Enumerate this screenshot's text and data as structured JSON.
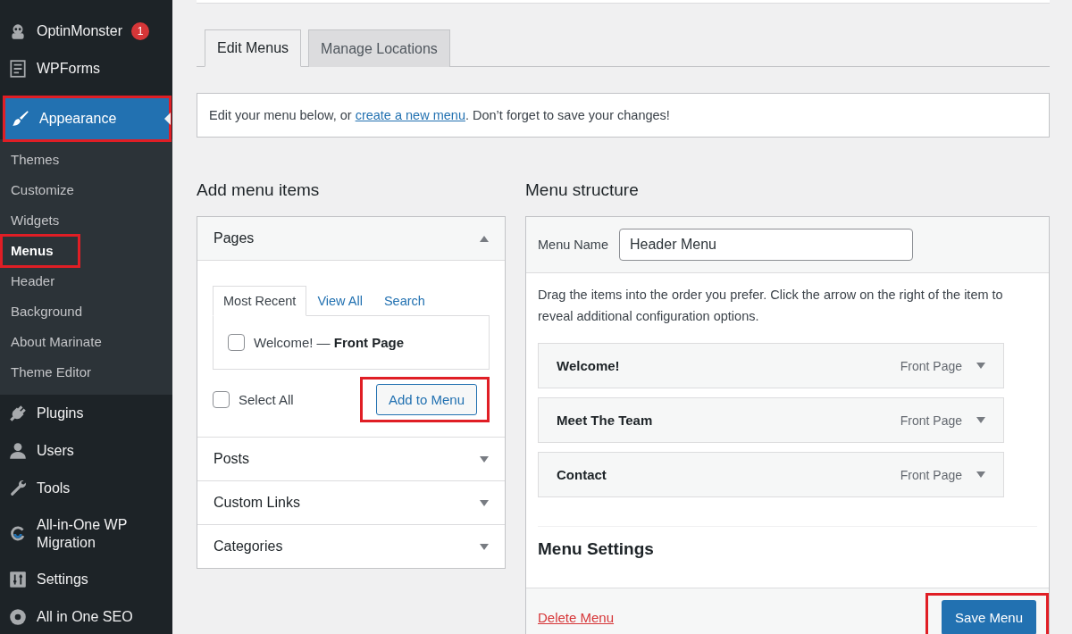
{
  "sidebar": {
    "items": [
      {
        "label": "OptinMonster",
        "badge": "1",
        "selected": false,
        "highlighted": false
      },
      {
        "label": "WPForms",
        "selected": false,
        "highlighted": false
      },
      {
        "label": "Appearance",
        "selected": true,
        "highlighted": true,
        "children": [
          {
            "label": "Themes",
            "selected": false,
            "highlighted": false
          },
          {
            "label": "Customize",
            "selected": false,
            "highlighted": false
          },
          {
            "label": "Widgets",
            "selected": false,
            "highlighted": false
          },
          {
            "label": "Menus",
            "selected": true,
            "highlighted": true
          },
          {
            "label": "Header",
            "selected": false,
            "highlighted": false
          },
          {
            "label": "Background",
            "selected": false,
            "highlighted": false
          },
          {
            "label": "About Marinate",
            "selected": false,
            "highlighted": false
          },
          {
            "label": "Theme Editor",
            "selected": false,
            "highlighted": false
          }
        ]
      },
      {
        "label": "Plugins",
        "selected": false,
        "highlighted": false
      },
      {
        "label": "Users",
        "selected": false,
        "highlighted": false
      },
      {
        "label": "Tools",
        "selected": false,
        "highlighted": false
      },
      {
        "label": "All-in-One WP Migration",
        "selected": false,
        "highlighted": false
      },
      {
        "label": "Settings",
        "selected": false,
        "highlighted": false
      },
      {
        "label": "All in One SEO",
        "selected": false,
        "highlighted": false
      }
    ]
  },
  "tabs": [
    {
      "label": "Edit Menus",
      "selected": true
    },
    {
      "label": "Manage Locations",
      "selected": false
    }
  ],
  "notice": {
    "before": "Edit your menu below, or ",
    "link": "create a new menu",
    "after": ". Don’t forget to save your changes!"
  },
  "add_items": {
    "title": "Add menu items",
    "sections": [
      {
        "title": "Pages",
        "expanded": true,
        "tabs": [
          {
            "label": "Most Recent",
            "selected": true
          },
          {
            "label": "View All",
            "selected": false
          },
          {
            "label": "Search",
            "selected": false
          }
        ],
        "entries": [
          {
            "title": "Welcome!",
            "separator": " — ",
            "state": "Front Page",
            "checked": false
          }
        ],
        "select_all": {
          "label": "Select All",
          "checked": false
        },
        "button": {
          "label": "Add to Menu",
          "highlighted": true
        }
      },
      {
        "title": "Posts",
        "expanded": false
      },
      {
        "title": "Custom Links",
        "expanded": false
      },
      {
        "title": "Categories",
        "expanded": false
      }
    ]
  },
  "structure": {
    "title": "Menu structure",
    "name_label": "Menu Name",
    "name_value": "Header Menu",
    "instructions": "Drag the items into the order you prefer. Click the arrow on the right of the item to reveal additional configuration options.",
    "items": [
      {
        "title": "Welcome!",
        "type": "Front Page"
      },
      {
        "title": "Meet The Team",
        "type": "Front Page"
      },
      {
        "title": "Contact",
        "type": "Front Page"
      }
    ],
    "settings_title": "Menu Settings",
    "delete_link": "Delete Menu",
    "save_button": {
      "label": "Save Menu",
      "highlighted": true
    }
  }
}
